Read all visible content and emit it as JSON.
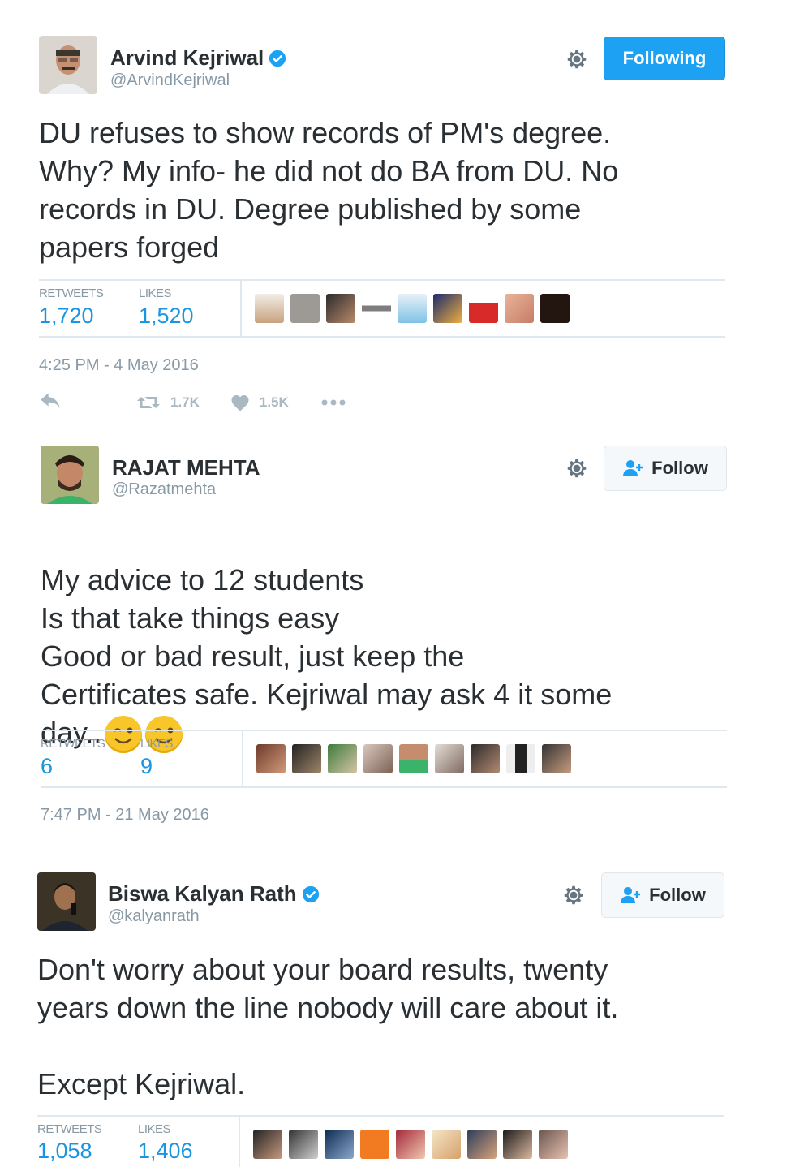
{
  "tweets": [
    {
      "name": "Arvind Kejriwal",
      "handle": "@ArvindKejriwal",
      "verified": true,
      "follow_button": "Following",
      "text": "DU refuses to show records of PM's degree.\nWhy? My info- he did not do BA from DU. No\nrecords in DU. Degree published by some\npapers forged",
      "retweets_label": "RETWEETS",
      "retweets": "1,720",
      "likes_label": "LIKES",
      "likes": "1,520",
      "timestamp": "4:25 PM - 4 May 2016",
      "action_retweets": "1.7K",
      "action_likes": "1.5K"
    },
    {
      "name": "RAJAT MEHTA",
      "handle": "@Razatmehta",
      "verified": false,
      "follow_button": "Follow",
      "text": "My advice to 12 students\nIs that take things easy\nGood or bad result, just keep the\nCertificates safe. Kejriwal may ask 4 it some\nday..",
      "retweets_label": "RETWEETS",
      "retweets": "6",
      "likes_label": "LIKES",
      "likes": "9",
      "timestamp": "7:47 PM - 21 May 2016"
    },
    {
      "name": "Biswa Kalyan Rath",
      "handle": "@kalyanrath",
      "verified": true,
      "follow_button": "Follow",
      "text": "Don't worry about your board results, twenty\nyears down the line nobody will care about it.\n\nExcept Kejriwal.",
      "retweets_label": "RETWEETS",
      "retweets": "1,058",
      "likes_label": "LIKES",
      "likes": "1,406"
    }
  ],
  "colors": {
    "accent": "#1da1f2",
    "link": "#1b95e0",
    "muted": "#8899a6",
    "divider": "#e1e8ed"
  },
  "icons": [
    "verified-icon",
    "gear-icon",
    "reply-icon",
    "retweet-icon",
    "heart-icon",
    "more-icon",
    "add-user-icon",
    "wink-emoji"
  ]
}
